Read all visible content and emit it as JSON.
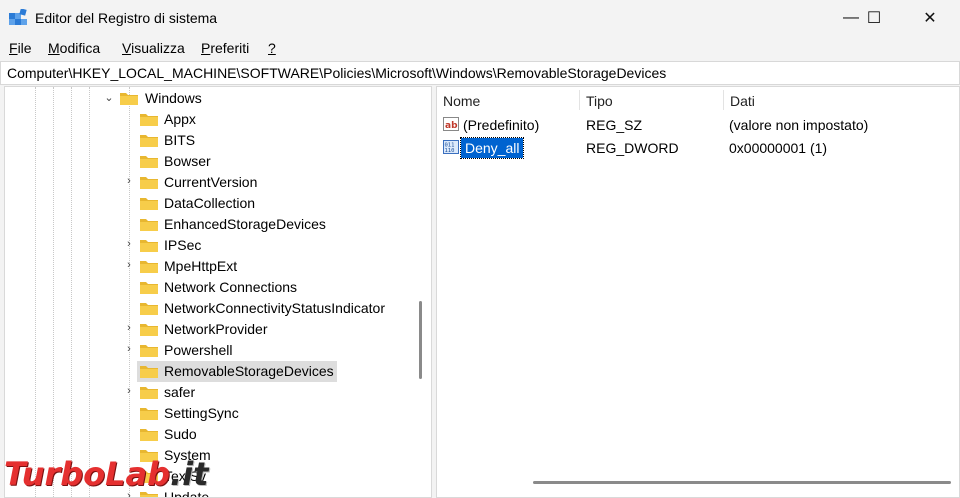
{
  "window": {
    "title": "Editor del Registro di sistema",
    "minimize_glyph": "—",
    "maximize_glyph": "☐",
    "close_glyph": "✕"
  },
  "menu": [
    {
      "label": "File",
      "accel": "F",
      "rest": "ile"
    },
    {
      "label": "Modifica",
      "accel": "M",
      "rest": "odifica"
    },
    {
      "label": "Visualizza",
      "accel": "V",
      "rest": "isualizza"
    },
    {
      "label": "Preferiti",
      "accel": "P",
      "rest": "referiti"
    },
    {
      "label": "?",
      "accel": "?",
      "rest": ""
    }
  ],
  "address_bar": {
    "path": "Computer\\HKEY_LOCAL_MACHINE\\SOFTWARE\\Policies\\Microsoft\\Windows\\RemovableStorageDevices"
  },
  "tree": {
    "parent": {
      "label": "Windows",
      "expanded": true
    },
    "children": [
      {
        "label": "Appx",
        "expandable": false
      },
      {
        "label": "BITS",
        "expandable": false
      },
      {
        "label": "Bowser",
        "expandable": false
      },
      {
        "label": "CurrentVersion",
        "expandable": true
      },
      {
        "label": "DataCollection",
        "expandable": false
      },
      {
        "label": "EnhancedStorageDevices",
        "expandable": false
      },
      {
        "label": "IPSec",
        "expandable": true
      },
      {
        "label": "MpeHttpExt",
        "expandable": true
      },
      {
        "label": "Network Connections",
        "expandable": false
      },
      {
        "label": "NetworkConnectivityStatusIndicator",
        "expandable": false
      },
      {
        "label": "NetworkProvider",
        "expandable": true
      },
      {
        "label": "Powershell",
        "expandable": true
      },
      {
        "label": "RemovableStorageDevices",
        "expandable": false,
        "selected": true
      },
      {
        "label": "safer",
        "expandable": true
      },
      {
        "label": "SettingSync",
        "expandable": false
      },
      {
        "label": "Sudo",
        "expandable": false
      },
      {
        "label": "System",
        "expandable": false
      },
      {
        "label": "TextSv",
        "expandable": false
      },
      {
        "label": "Update",
        "expandable": true
      }
    ]
  },
  "list": {
    "columns": {
      "name": "Nome",
      "type": "Tipo",
      "data": "Dati"
    },
    "rows": [
      {
        "icon": "string-value-icon",
        "name": "(Predefinito)",
        "type": "REG_SZ",
        "data": "(valore non impostato)"
      },
      {
        "icon": "dword-value-icon",
        "name": "Deny_all",
        "type": "REG_DWORD",
        "data": "0x00000001 (1)",
        "selected": true
      }
    ]
  },
  "watermark": {
    "part1": "TurboLab",
    "part2": ".it"
  },
  "colors": {
    "selection": "#0063d0",
    "folder": "#f4c542",
    "tree_selection": "#dddddd"
  }
}
